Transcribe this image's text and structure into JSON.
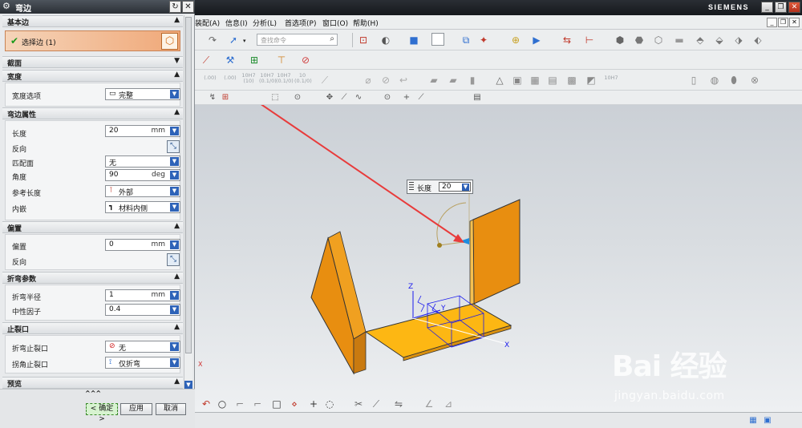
{
  "app": {
    "brand": "SIEMENS",
    "window_buttons": [
      "_",
      "❐",
      "✕"
    ],
    "mdi_buttons": [
      "_",
      "❐",
      "✕"
    ]
  },
  "menubar": {
    "items": [
      "装配(A)",
      "信息(I)",
      "分析(L)",
      "首选项(P)",
      "窗口(O)",
      "帮助(H)"
    ]
  },
  "search": {
    "placeholder": "查找命令"
  },
  "toolbar_text": {
    "dims": [
      "(.00)",
      "(.00)",
      "10H7\n(10)",
      "10H7\n(0.1/0)",
      "10H7\n(0.1/0)",
      "10\n(0.1/0)",
      "10H7"
    ]
  },
  "dialog": {
    "title": "弯边",
    "sections": {
      "base_edge": "基本边",
      "profile": "截面",
      "width": "宽度",
      "flange_props": "弯边属性",
      "offset": "偏置",
      "bend_params": "折弯参数",
      "relief": "止裂口",
      "preview": "预览"
    },
    "select_edge": "选择边 (1)",
    "width_option_label": "宽度选项",
    "width_option_value": "完整",
    "length_label": "长度",
    "length_value": "20",
    "length_unit": "mm",
    "reverse_label": "反向",
    "match_face_label": "匹配面",
    "match_face_value": "无",
    "angle_label": "角度",
    "angle_value": "90",
    "angle_unit": "deg",
    "ref_length_label": "参考长度",
    "ref_length_value": "外部",
    "inset_label": "内嵌",
    "inset_value": "材料内侧",
    "offset_label": "偏置",
    "offset_value": "0",
    "offset_unit": "mm",
    "offset_reverse_label": "反向",
    "bend_radius_label": "折弯半径",
    "bend_radius_value": "1",
    "bend_radius_unit": "mm",
    "neutral_factor_label": "中性因子",
    "neutral_factor_value": "0.4",
    "bend_relief_label": "折弯止裂口",
    "bend_relief_value": "无",
    "corner_relief_label": "拐角止裂口",
    "corner_relief_value": "仅折弯",
    "footer_carets": "^^^",
    "ok_label": "< 确定 >",
    "apply_label": "应用",
    "cancel_label": "取消"
  },
  "viewport": {
    "length_popup_label": "长度",
    "length_popup_value": "20",
    "axis_labels": {
      "z": "Z",
      "y": "Y",
      "x": "X",
      "x2": "X"
    },
    "colors": {
      "flange": "#f0a020",
      "flange_dark": "#c97a10",
      "base": "#fdb713",
      "arrow": "#e83b3b",
      "axis": "#1a1aee"
    }
  },
  "watermark": {
    "logo": "Bai  经验",
    "url": "jingyan.baidu.com"
  }
}
